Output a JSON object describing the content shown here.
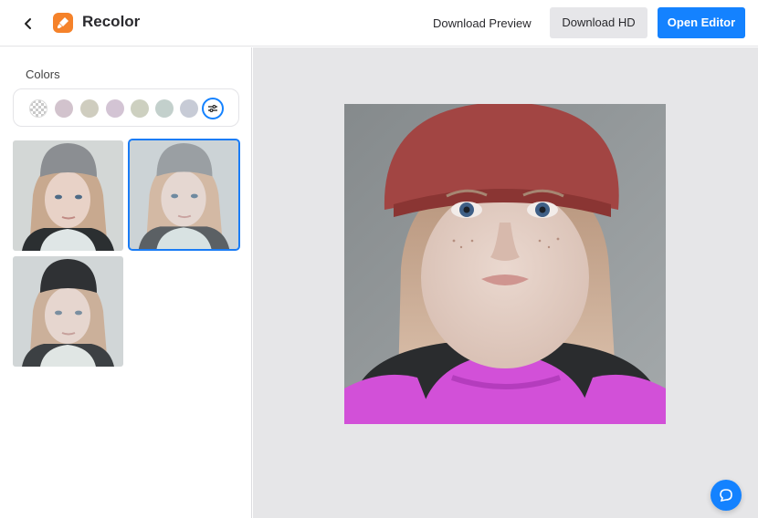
{
  "header": {
    "back_icon": "chevron-left-icon",
    "logo_icon": "brush-icon",
    "title": "Recolor",
    "download_preview_label": "Download Preview",
    "download_hd_label": "Download HD",
    "open_editor_label": "Open Editor"
  },
  "sidebar": {
    "colors_label": "Colors",
    "swatches": [
      {
        "name": "transparent",
        "color": "transparent"
      },
      {
        "name": "mauve",
        "color": "#d2c3cd"
      },
      {
        "name": "beige-grey",
        "color": "#cfcdbf"
      },
      {
        "name": "lilac",
        "color": "#d3c4d4"
      },
      {
        "name": "sage",
        "color": "#cdd0c0"
      },
      {
        "name": "grey-mint",
        "color": "#c3d0cc"
      },
      {
        "name": "blue-grey",
        "color": "#c7cbd6"
      }
    ],
    "settings_icon": "sliders-icon",
    "thumbnails": [
      {
        "variant": "grey-hat",
        "selected": false
      },
      {
        "variant": "light-grey-hat",
        "selected": true
      },
      {
        "variant": "black-hat",
        "selected": false
      }
    ]
  },
  "preview": {
    "subject": "girl in red beanie and magenta top",
    "accent": "#d250d8"
  },
  "help_icon": "chat-bubble-icon"
}
